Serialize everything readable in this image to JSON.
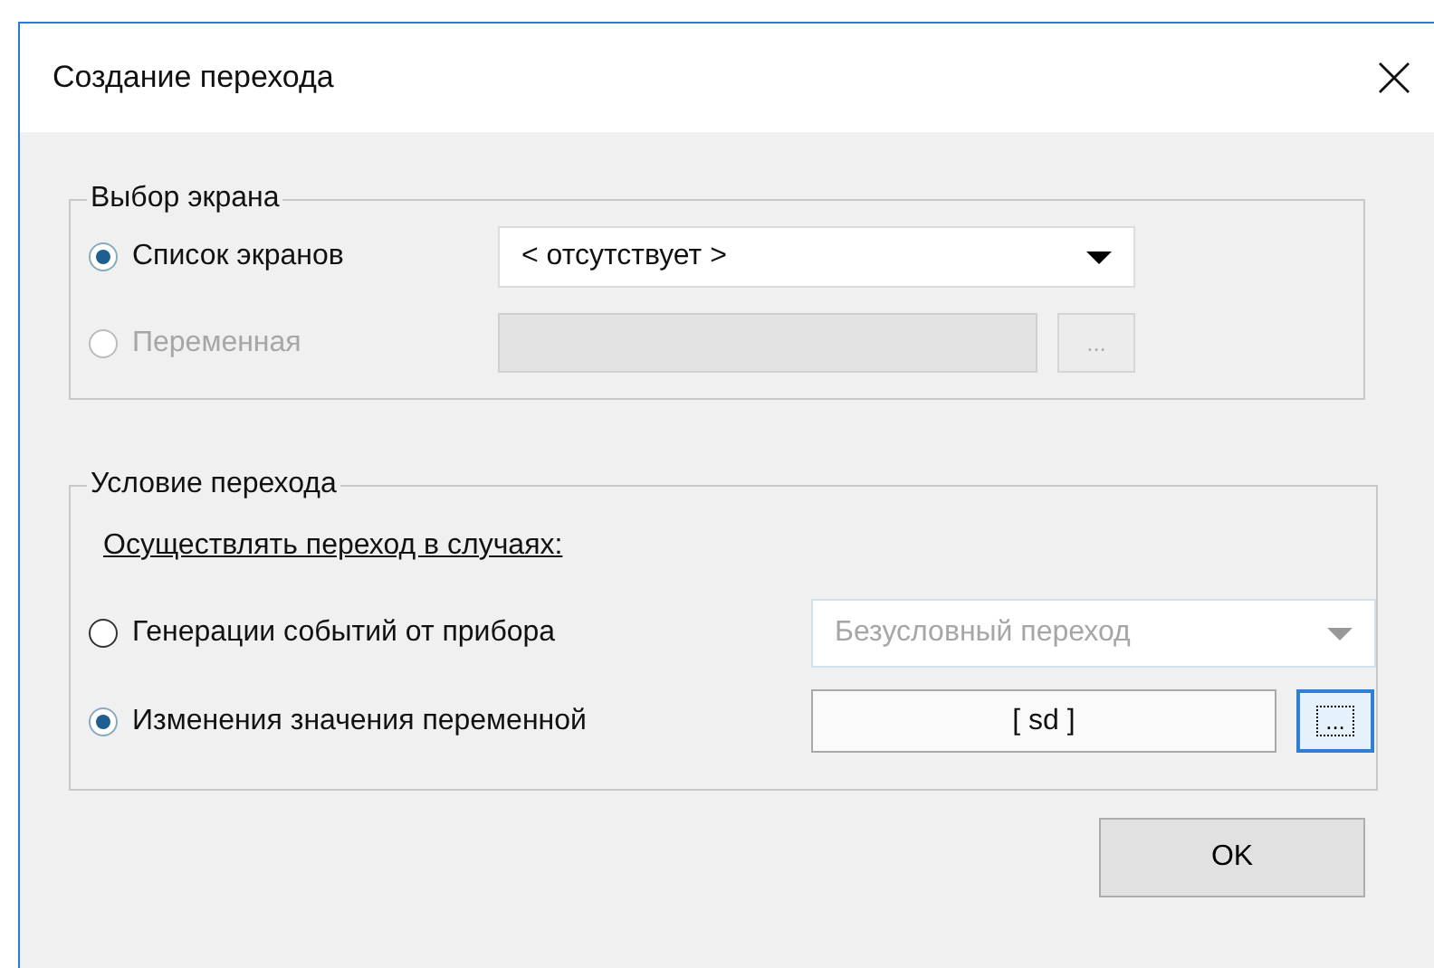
{
  "window": {
    "title": "Создание перехода"
  },
  "screen_choice": {
    "legend": "Выбор экрана",
    "rows": [
      {
        "label": "Список экранов",
        "selected": true,
        "disabled": false,
        "control": {
          "kind": "dropdown",
          "value": "< отсутствует >",
          "disabled": false
        }
      },
      {
        "label": "Переменная",
        "selected": false,
        "disabled": true,
        "control": {
          "kind": "field",
          "disabled": true,
          "browse": "...",
          "focused": false
        }
      }
    ]
  },
  "transition_condition": {
    "legend": "Условие перехода",
    "caption": "Осуществлять переход в случаях:",
    "rows": [
      {
        "label": "Генерации событий от прибора",
        "selected": false,
        "disabled": false,
        "control": {
          "kind": "dropdown",
          "value": "Безусловный переход",
          "disabled": true
        }
      },
      {
        "label": "Изменения значения переменной",
        "selected": true,
        "disabled": false,
        "control": {
          "kind": "field",
          "value": "[ sd ]",
          "disabled": false,
          "browse": "...",
          "focused": true
        }
      }
    ]
  },
  "buttons": [
    {
      "label": "OK"
    }
  ]
}
